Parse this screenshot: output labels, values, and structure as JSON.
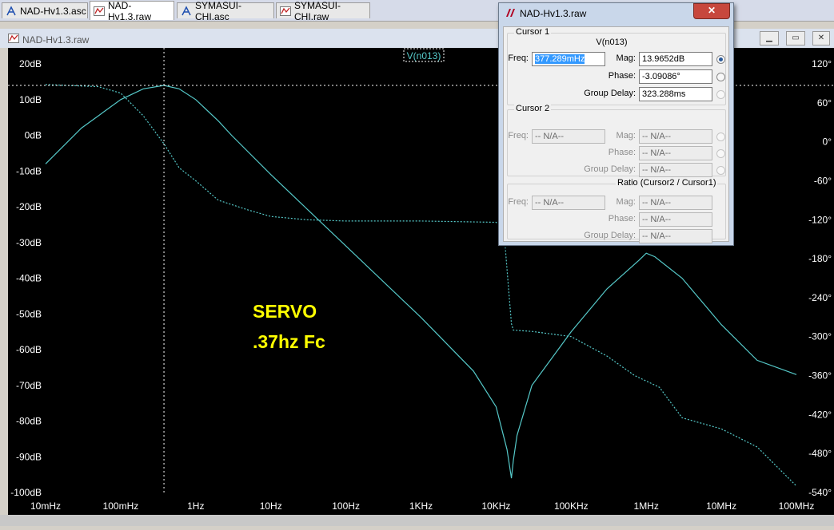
{
  "tabs": [
    {
      "label": "NAD-Hv1.3.asc",
      "icon": "schematic-icon"
    },
    {
      "label": "NAD-Hv1.3.raw",
      "icon": "waveform-icon"
    },
    {
      "label": "SYMASUI-CHI.asc",
      "icon": "schematic-icon"
    },
    {
      "label": "SYMASUI-CHI.raw",
      "icon": "waveform-icon"
    }
  ],
  "window": {
    "title": "NAD-Hv1.3.raw",
    "minimize": "▁",
    "restore": "▭",
    "close": "✕"
  },
  "plot": {
    "trace_name": "V(n013)",
    "annotation_line1": "SERVO",
    "annotation_line2": ".37hz Fc",
    "colors": {
      "trace": "#55c8c8",
      "cursor": "#ffffff",
      "annotation": "#ffff00",
      "axis_text": "#ffffff"
    }
  },
  "chart_data": {
    "type": "line",
    "title": "",
    "xscale": "log",
    "xlim": [
      0.01,
      100000000
    ],
    "xticks": [
      "10mHz",
      "100mHz",
      "1Hz",
      "10Hz",
      "100Hz",
      "1KHz",
      "10KHz",
      "100KHz",
      "1MHz",
      "10MHz",
      "100MHz"
    ],
    "ylim_left": [
      -100,
      20
    ],
    "yticks_left": [
      "20dB",
      "10dB",
      "0dB",
      "-10dB",
      "-20dB",
      "-30dB",
      "-40dB",
      "-50dB",
      "-60dB",
      "-70dB",
      "-80dB",
      "-90dB",
      "-100dB"
    ],
    "ylim_right": [
      -540,
      120
    ],
    "yticks_right": [
      "120°",
      "60°",
      "0°",
      "-60°",
      "-120°",
      "-180°",
      "-240°",
      "-300°",
      "-360°",
      "-420°",
      "-480°",
      "-540°"
    ],
    "grid": false,
    "series": [
      {
        "name": "V(n013)",
        "quantity": "magnitude",
        "style": "solid",
        "x": [
          0.01,
          0.03,
          0.1,
          0.2,
          0.377,
          0.6,
          1,
          2,
          3,
          10,
          100,
          1000,
          5000,
          10000,
          14000,
          16000,
          17000,
          19000,
          30000,
          100000,
          300000,
          800000,
          1000000,
          1300000,
          3000000,
          10000000,
          30000000,
          100000000
        ],
        "y": [
          -8,
          2,
          10,
          13,
          13.97,
          13,
          10,
          4,
          0,
          -11,
          -31,
          -51,
          -66,
          -76,
          -88,
          -96,
          -91,
          -84,
          -70,
          -55,
          -43,
          -35,
          -33,
          -34,
          -40,
          -53,
          -63,
          -67
        ]
      },
      {
        "name": "V(n013)",
        "quantity": "phase",
        "style": "dashed",
        "x": [
          0.01,
          0.05,
          0.1,
          0.2,
          0.377,
          0.6,
          1,
          2,
          5,
          10,
          30,
          100,
          1000,
          10000,
          12000,
          13000,
          15000,
          16000,
          17000,
          30000,
          100000,
          300000,
          700000,
          1500000,
          3000000,
          10000000,
          30000000,
          100000000
        ],
        "y": [
          88,
          85,
          75,
          40,
          -3,
          -40,
          -60,
          -90,
          -105,
          -115,
          -120,
          -122,
          -122,
          -124,
          -130,
          -150,
          -240,
          -280,
          -290,
          -292,
          -300,
          -330,
          -360,
          -378,
          -425,
          -442,
          -470,
          -530
        ]
      }
    ]
  },
  "cursor_dialog": {
    "title": "NAD-Hv1.3.raw",
    "close": "✕",
    "cursor1": {
      "caption": "Cursor 1",
      "trace": "V(n013)",
      "freq_label": "Freq:",
      "freq": "377.289mHz",
      "mag_label": "Mag:",
      "mag": "13.9652dB",
      "phase_label": "Phase:",
      "phase": "-3.09086°",
      "gd_label": "Group Delay:",
      "gd": "323.288ms"
    },
    "cursor2": {
      "caption": "Cursor 2",
      "freq_label": "Freq:",
      "freq": "-- N/A--",
      "mag_label": "Mag:",
      "mag": "-- N/A--",
      "phase_label": "Phase:",
      "phase": "-- N/A--",
      "gd_label": "Group Delay:",
      "gd": "-- N/A--"
    },
    "ratio": {
      "caption": "Ratio (Cursor2 / Cursor1)",
      "freq_label": "Freq:",
      "freq": "-- N/A--",
      "mag_label": "Mag:",
      "mag": "-- N/A--",
      "phase_label": "Phase:",
      "phase": "-- N/A--",
      "gd_label": "Group Delay:",
      "gd": "-- N/A--"
    }
  }
}
